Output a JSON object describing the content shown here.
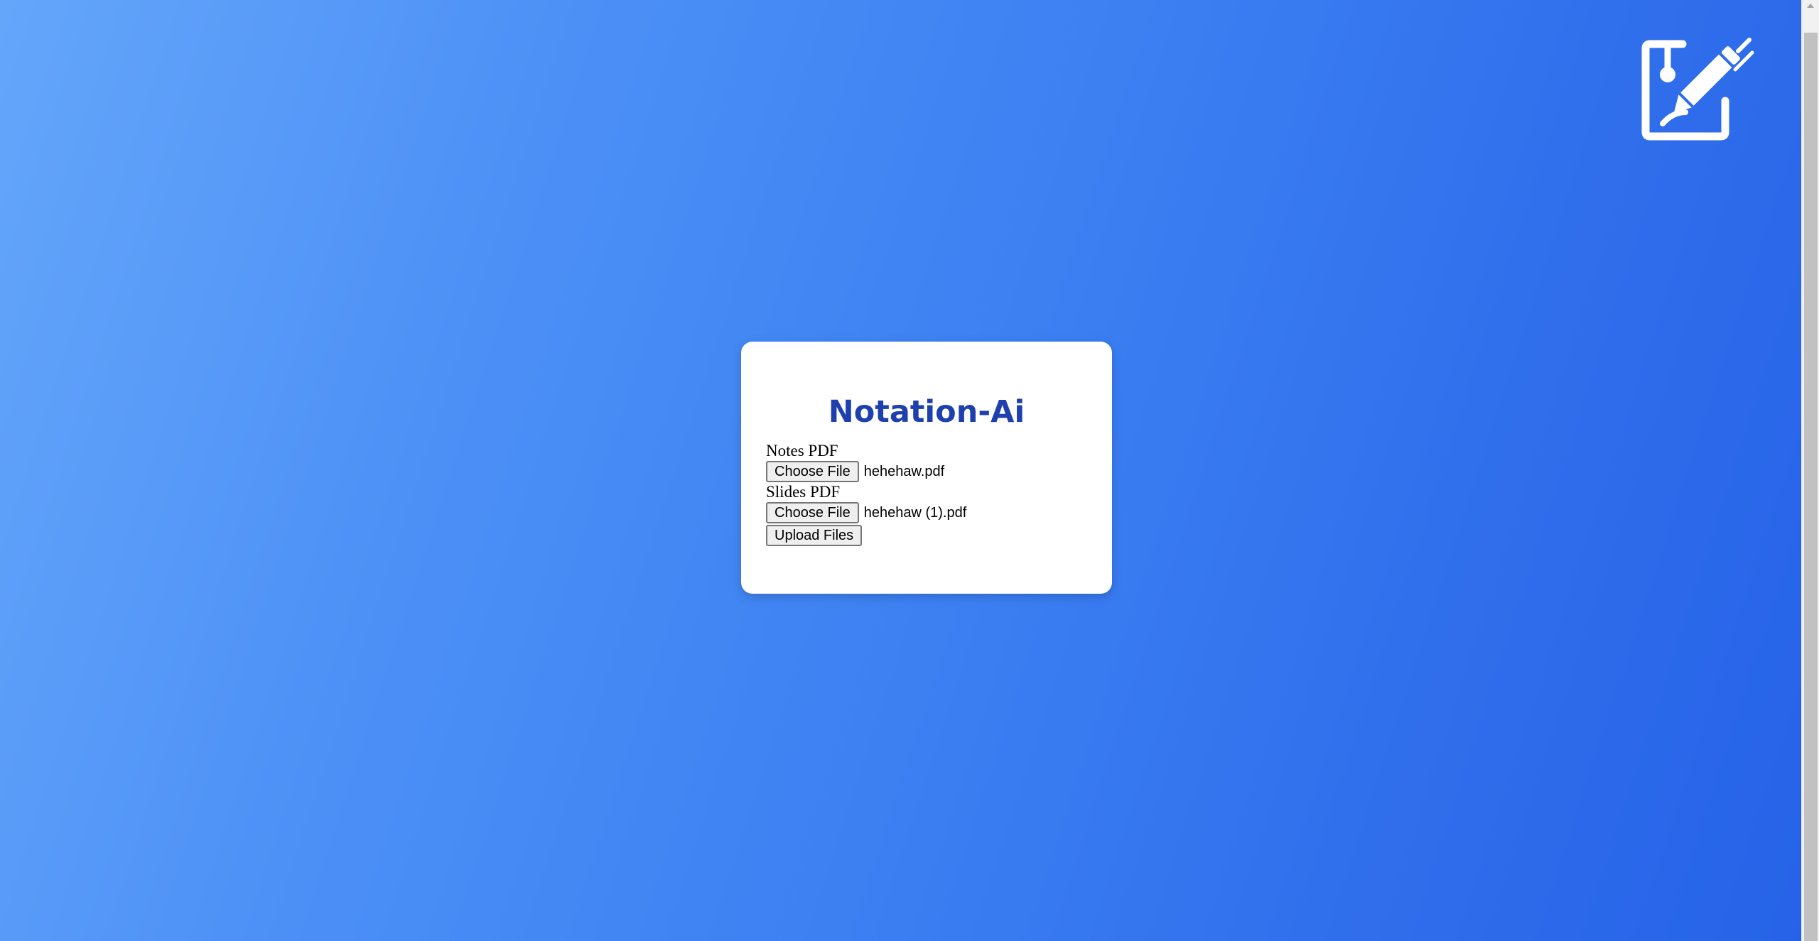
{
  "app": {
    "title": "Notation-Ai",
    "logo_icon": "edit-document-pen-icon"
  },
  "form": {
    "notes": {
      "label": "Notes PDF",
      "button_label": "Choose File",
      "file_name": "hehehaw.pdf"
    },
    "slides": {
      "label": "Slides PDF",
      "button_label": "Choose File",
      "file_name": "hehehaw (1).pdf"
    },
    "upload_label": "Upload Files"
  },
  "colors": {
    "title": "#1e40af",
    "background_start": "#64a6fa",
    "background_end": "#2562e8"
  }
}
